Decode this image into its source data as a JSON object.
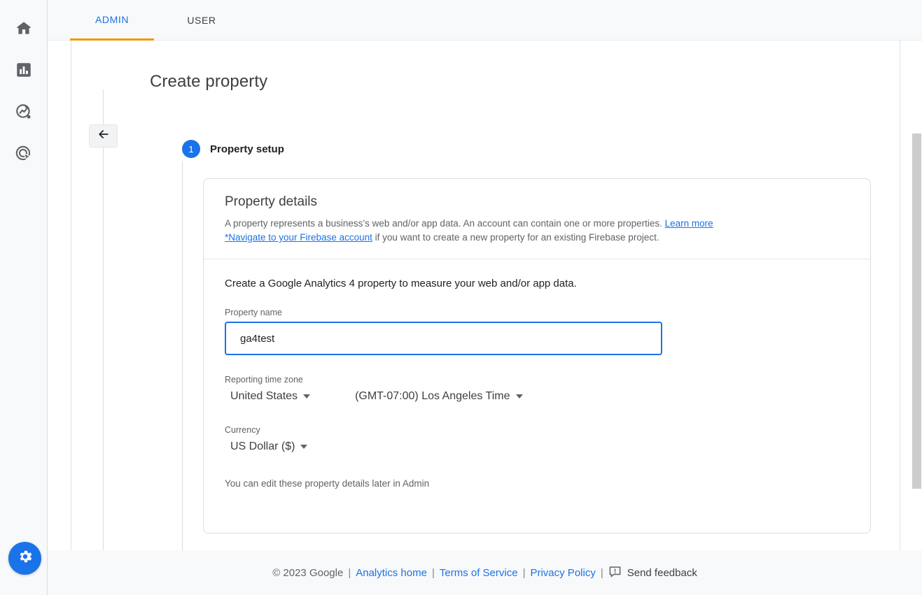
{
  "colors": {
    "accent_blue": "#1a73e8",
    "tab_underline": "#f29900",
    "rail_bg": "#f8f9fa",
    "text_primary": "#202124",
    "text_secondary": "#5f6368",
    "border": "#dadce0"
  },
  "sidebar": {
    "items": [
      {
        "name": "home-icon",
        "label": "Home"
      },
      {
        "name": "reports-icon",
        "label": "Reports"
      },
      {
        "name": "explore-icon",
        "label": "Explore"
      },
      {
        "name": "advertising-icon",
        "label": "Advertising"
      }
    ],
    "fab": {
      "name": "gear-icon",
      "label": "Admin"
    }
  },
  "tabs": [
    {
      "label": "ADMIN",
      "selected": true
    },
    {
      "label": "USER",
      "selected": false
    }
  ],
  "page": {
    "title": "Create property",
    "back_button_label": "Back"
  },
  "stepper": {
    "step_number": "1",
    "step_label": "Property setup"
  },
  "card": {
    "heading": "Property details",
    "description_prefix": "A property represents a business’s web and/or app data. An account can contain one or more properties. ",
    "learn_more_link": "Learn more",
    "firebase_link": "*Navigate to your Firebase account",
    "description_suffix": " if you want to create a new property for an existing Firebase project.",
    "intro_line": "Create a Google Analytics 4 property to measure your web and/or app data.",
    "property_name": {
      "label": "Property name",
      "value": "ga4test",
      "placeholder": "Property name"
    },
    "reporting_time_zone": {
      "label": "Reporting time zone",
      "country_value": "United States",
      "zone_value": "(GMT-07:00) Los Angeles Time"
    },
    "currency": {
      "label": "Currency",
      "value": "US Dollar ($)"
    },
    "edit_note": "You can edit these property details later in Admin"
  },
  "footer": {
    "copyright": "© 2023 Google",
    "sep": "|",
    "analytics_home": "Analytics home",
    "terms": "Terms of Service",
    "privacy": "Privacy Policy",
    "send_feedback": "Send feedback",
    "feedback_icon": "feedback-bubble-icon"
  }
}
